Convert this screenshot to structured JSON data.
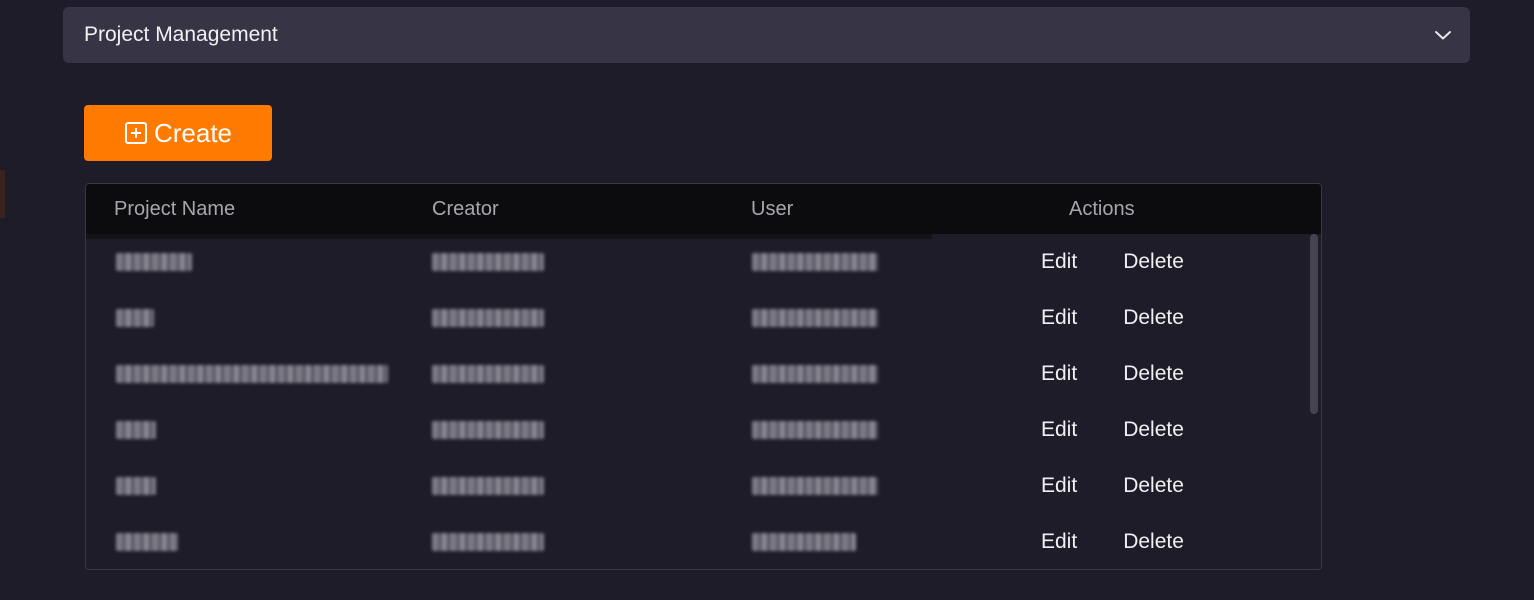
{
  "panel": {
    "title": "Project Management",
    "expand_icon": "chevron-down-icon"
  },
  "toolbar": {
    "create_label": "Create",
    "create_icon": "plus-square-icon",
    "create_color": "#ff7a00"
  },
  "table": {
    "columns": [
      "Project Name",
      "Creator",
      "User",
      "Actions"
    ],
    "rows": [
      {
        "project_name": "",
        "creator": "",
        "user": "",
        "edit": "Edit",
        "delete": "Delete"
      },
      {
        "project_name": "",
        "creator": "",
        "user": "",
        "edit": "Edit",
        "delete": "Delete"
      },
      {
        "project_name": "",
        "creator": "",
        "user": "",
        "edit": "Edit",
        "delete": "Delete"
      },
      {
        "project_name": "",
        "creator": "",
        "user": "",
        "edit": "Edit",
        "delete": "Delete"
      },
      {
        "project_name": "",
        "creator": "",
        "user": "",
        "edit": "Edit",
        "delete": "Delete"
      },
      {
        "project_name": "",
        "creator": "",
        "user": "",
        "edit": "Edit",
        "delete": "Delete"
      }
    ]
  }
}
